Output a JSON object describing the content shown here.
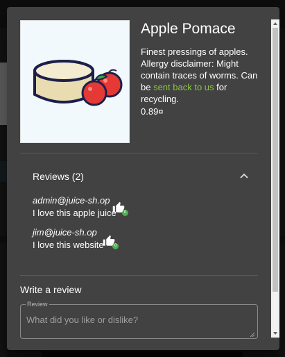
{
  "product": {
    "title": "Apple Pomace",
    "description_before": "Finest pressings of apples. Allergy disclaimer: Might contain traces of worms. Can be ",
    "description_link": "sent back to us",
    "description_after": " for recycling.",
    "price": "0.89¤"
  },
  "reviews": {
    "title": "Reviews",
    "count": "(2)",
    "items": [
      {
        "author": "admin@juice-sh.op",
        "message": "I love this apple juice",
        "likes": "0"
      },
      {
        "author": "jim@juice-sh.op",
        "message": "I love this website",
        "likes": "0"
      }
    ]
  },
  "write_review": {
    "title": "Write a review",
    "label": "Review",
    "placeholder": "What did you like or dislike?"
  },
  "colors": {
    "link": "#8bc34a",
    "dialog_bg": "#424242",
    "like_badge": "#4caf50"
  },
  "icons": [
    "chevron-up-icon",
    "thumb-up-icon",
    "apple-pomace-image"
  ]
}
